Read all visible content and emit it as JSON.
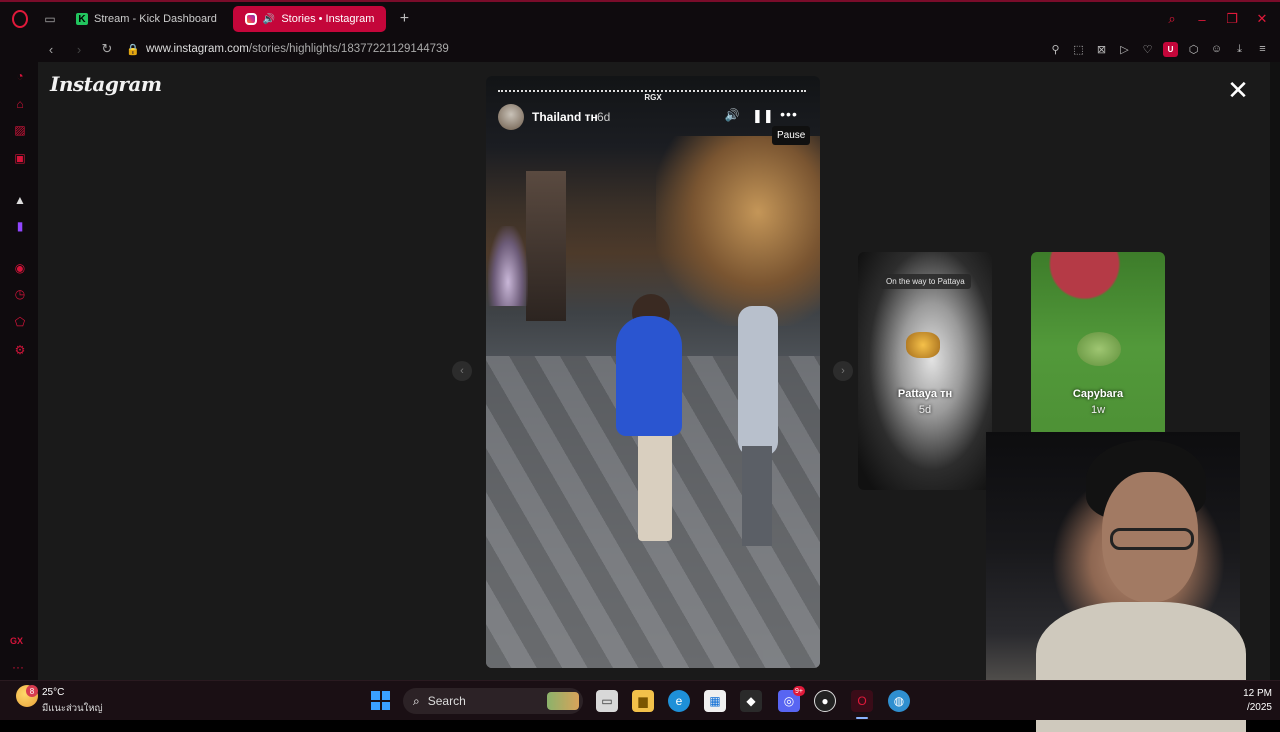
{
  "browser": {
    "tabs": [
      {
        "label": "Stream - Kick Dashboard",
        "active": false
      },
      {
        "label": "Stories • Instagram",
        "active": true
      }
    ],
    "url_domain": "www.instagram.com",
    "url_path": "/stories/highlights/18377221129144739"
  },
  "page": {
    "logo": "Instagram",
    "close": "✕"
  },
  "story": {
    "top_label": "RGX",
    "username": "Thailand ᴛʜ",
    "age": "6d",
    "tooltip": "Pause"
  },
  "highlights": [
    {
      "title": "Pattaya ᴛʜ",
      "age": "5d",
      "tag": "On the way to Pattaya"
    },
    {
      "title": "Capybara",
      "age": "1w"
    }
  ],
  "taskbar": {
    "weather_badge": "8",
    "temperature": "25°C",
    "location": "มีแนะส่วนใหญ่",
    "search_label": "Search",
    "discord_badge": "9+",
    "clock_time": "12 PM",
    "clock_date": "/2025"
  },
  "colors": {
    "accent": "#c4063a",
    "opera_red": "#e0193a",
    "page_bg": "#1a1a1a"
  }
}
